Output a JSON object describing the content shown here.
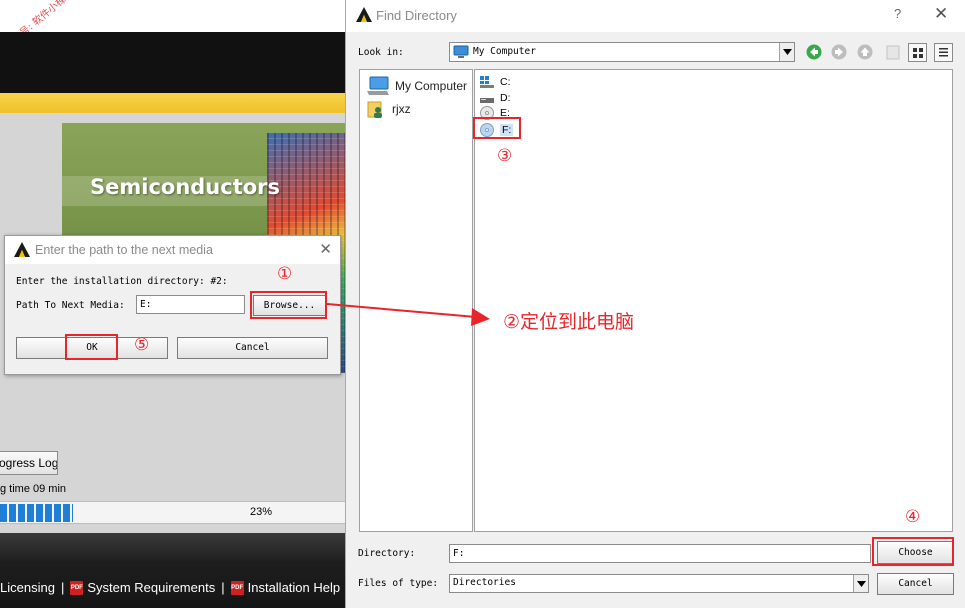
{
  "background_installer": {
    "watermark": "公众号: 软件小梯",
    "banner_title": "Semiconductors",
    "progress_log_button": "ogress Log",
    "remaining_text": "g time 09 min",
    "progress_percent_text": "23%",
    "progress_value": 0.23,
    "footer_links": [
      {
        "label": "Licensing",
        "icon": "none"
      },
      {
        "label": "System Requirements",
        "icon": "pdf-icon"
      },
      {
        "label": "Installation Help",
        "icon": "pdf-icon"
      }
    ],
    "footer_separator": "|"
  },
  "media_dialog": {
    "title": "Enter the path to the next media",
    "close_glyph": "✕",
    "install_dir_text": "Enter the installation directory: #2:",
    "path_label": "Path To Next Media:",
    "path_value": "E:",
    "browse_label": "Browse...",
    "ok_label": "OK",
    "cancel_label": "Cancel"
  },
  "find_dialog": {
    "title": "Find Directory",
    "help_glyph": "?",
    "close_glyph": "✕",
    "look_in_label": "Look in:",
    "look_in_value": "My Computer",
    "places": [
      {
        "label": "My Computer",
        "icon": "computer-icon"
      },
      {
        "label": "rjxz",
        "icon": "user-folder-icon"
      }
    ],
    "drives": [
      {
        "label": "C:",
        "icon": "windows-drive-icon",
        "selected": false
      },
      {
        "label": "D:",
        "icon": "hard-drive-icon",
        "selected": false
      },
      {
        "label": "E:",
        "icon": "optical-drive-icon",
        "selected": false
      },
      {
        "label": "F:",
        "icon": "optical-drive-icon",
        "selected": true
      }
    ],
    "directory_label": "Directory:",
    "directory_value": "F:",
    "files_of_type_label": "Files of type:",
    "files_of_type_value": "Directories",
    "choose_label": "Choose",
    "cancel_label": "Cancel"
  },
  "annotations": {
    "step1": "①",
    "step2": "②定位到此电脑",
    "step3": "③",
    "step4": "④",
    "step5": "⑤",
    "accent_color": "#e8252b"
  }
}
